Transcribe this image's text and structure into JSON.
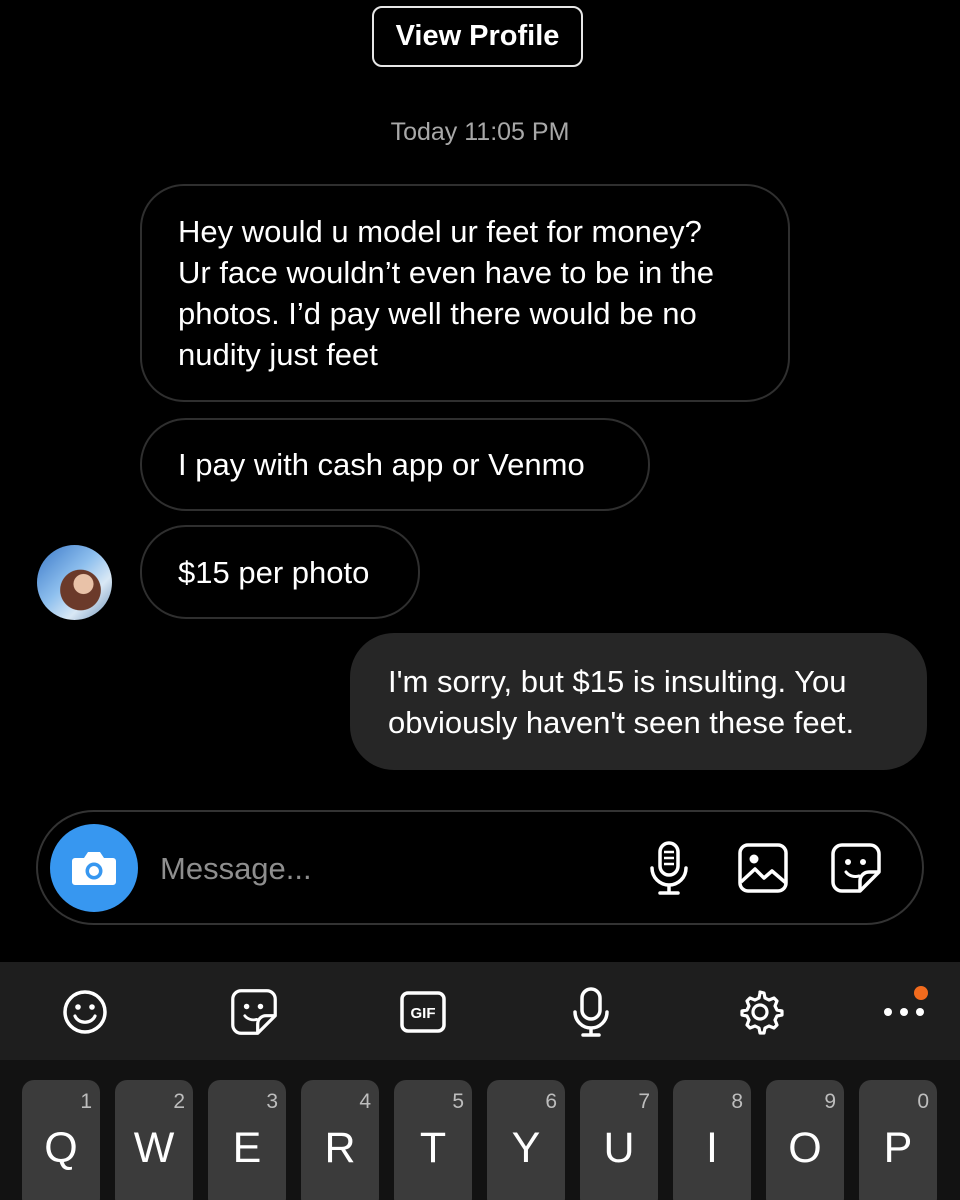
{
  "header": {
    "view_profile_label": "View Profile"
  },
  "conversation": {
    "timestamp": "Today 11:05 PM",
    "incoming": [
      {
        "lines": [
          "Hey would u model ur feet for money?",
          "Ur face wouldn’t even have to be in the",
          "photos. I’d pay well  there would be no",
          "nudity just feet"
        ]
      },
      {
        "lines": [
          "I pay with cash app or Venmo"
        ]
      },
      {
        "lines": [
          "$15 per photo"
        ]
      }
    ],
    "outgoing": [
      {
        "lines": [
          "I'm sorry, but $15 is insulting. You",
          "obviously haven't seen these feet."
        ]
      }
    ]
  },
  "composer": {
    "placeholder": "Message..."
  },
  "keyboard_toolbar": {
    "gif_label": "GIF",
    "more_label": "•••"
  },
  "keyboard": {
    "keys": [
      {
        "letter": "Q",
        "num": "1"
      },
      {
        "letter": "W",
        "num": "2"
      },
      {
        "letter": "E",
        "num": "3"
      },
      {
        "letter": "R",
        "num": "4"
      },
      {
        "letter": "T",
        "num": "5"
      },
      {
        "letter": "Y",
        "num": "6"
      },
      {
        "letter": "U",
        "num": "7"
      },
      {
        "letter": "I",
        "num": "8"
      },
      {
        "letter": "O",
        "num": "9"
      },
      {
        "letter": "P",
        "num": "0"
      }
    ]
  },
  "colors": {
    "background": "#000000",
    "outgoing_bubble": "#262626",
    "camera_button": "#3797f0",
    "notification_dot": "#f26b1d",
    "key": "#3b3b3b"
  }
}
